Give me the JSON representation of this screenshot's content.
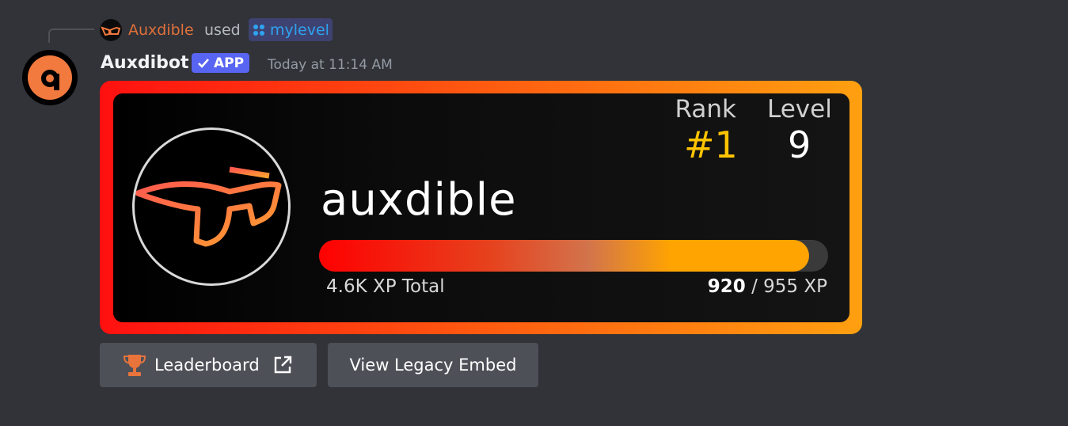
{
  "reply": {
    "username": "Auxdible",
    "used_text": "used",
    "command": "mylevel",
    "avatar_icon": "glasses-icon"
  },
  "message": {
    "bot_name": "Auxdibot",
    "badge": "APP",
    "timestamp": "Today at 11:14 AM",
    "avatar_icon": "auxdibot-logo-icon"
  },
  "rank_card": {
    "rank_label": "Rank",
    "rank_value": "#1",
    "level_label": "Level",
    "level_value": "9",
    "username": "auxdible",
    "xp_total": "4.6K XP Total",
    "xp_current": "920",
    "xp_separator": " / ",
    "xp_needed": "955 XP",
    "xp_fraction": 0.9634,
    "colors": {
      "border_start": "#ff1010",
      "border_end": "#ffa010",
      "rank_value": "#ffc400",
      "bar_start": "#ff0000",
      "bar_end": "#ffa400"
    }
  },
  "buttons": {
    "leaderboard": "Leaderboard",
    "legacy_embed": "View Legacy Embed"
  }
}
